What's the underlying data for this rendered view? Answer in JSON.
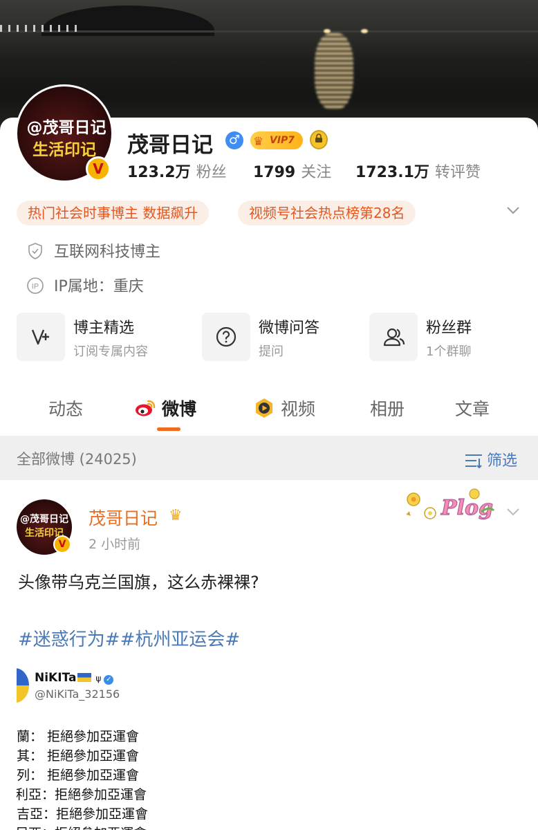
{
  "profile": {
    "avatar_line1": "@茂哥日记",
    "avatar_line2": "生活印记",
    "verified_badge": "V",
    "name": "茂哥日记",
    "gender_symbol": "♂",
    "vip_label": "VIP7",
    "stats": [
      {
        "num": "123.2万",
        "label": "粉丝"
      },
      {
        "num": "1799",
        "label": "关注"
      },
      {
        "num": "1723.1万",
        "label": "转评赞"
      }
    ],
    "tags": [
      "热门社会时事博主 数据飙升",
      "视频号社会热点榜第28名"
    ],
    "info": [
      {
        "icon": "shield-check-icon",
        "text": "互联网科技博主"
      },
      {
        "icon": "ip-location-icon",
        "text": "IP属地：重庆"
      }
    ],
    "features": [
      {
        "icon": "v-plus-icon",
        "title": "博主精选",
        "sub": "订阅专属内容"
      },
      {
        "icon": "question-icon",
        "title": "微博问答",
        "sub": "提问"
      },
      {
        "icon": "group-icon",
        "title": "粉丝群",
        "sub": "1个群聊"
      }
    ]
  },
  "tabs": [
    {
      "label": "动态",
      "active": false
    },
    {
      "label": "微博",
      "active": true,
      "icon": "weibo-logo-icon"
    },
    {
      "label": "视频",
      "active": false,
      "icon": "video-play-icon"
    },
    {
      "label": "相册",
      "active": false
    },
    {
      "label": "文章",
      "active": false
    }
  ],
  "filterbar": {
    "all_label": "全部微博 (24025)",
    "filter_label": "筛选"
  },
  "post": {
    "avatar_line1": "@茂哥日记",
    "avatar_line2": "生活印记",
    "verified_badge": "V",
    "author": "茂哥日记",
    "time": "2 小时前",
    "sticker_text": "Plog",
    "text": "头像带乌克兰国旗，这么赤裸裸?",
    "hashtags": "#迷惑行为##杭州亚运会#",
    "embed": {
      "name": "NiKITa",
      "handle": "@NiKiTa_32156",
      "rows": [
        "蘭：  拒絕參加亞運會",
        "其：  拒絕參加亞運會",
        "列：  拒絕參加亞運會",
        "利亞：拒絕參加亞運會",
        "吉亞：拒絕參加亞運會",
        "尼西：拒絕參加亞運會"
      ]
    }
  },
  "colors": {
    "accent_orange": "#e86c23",
    "link_blue": "#4a79b8",
    "tag_bg": "#fbeee7"
  }
}
